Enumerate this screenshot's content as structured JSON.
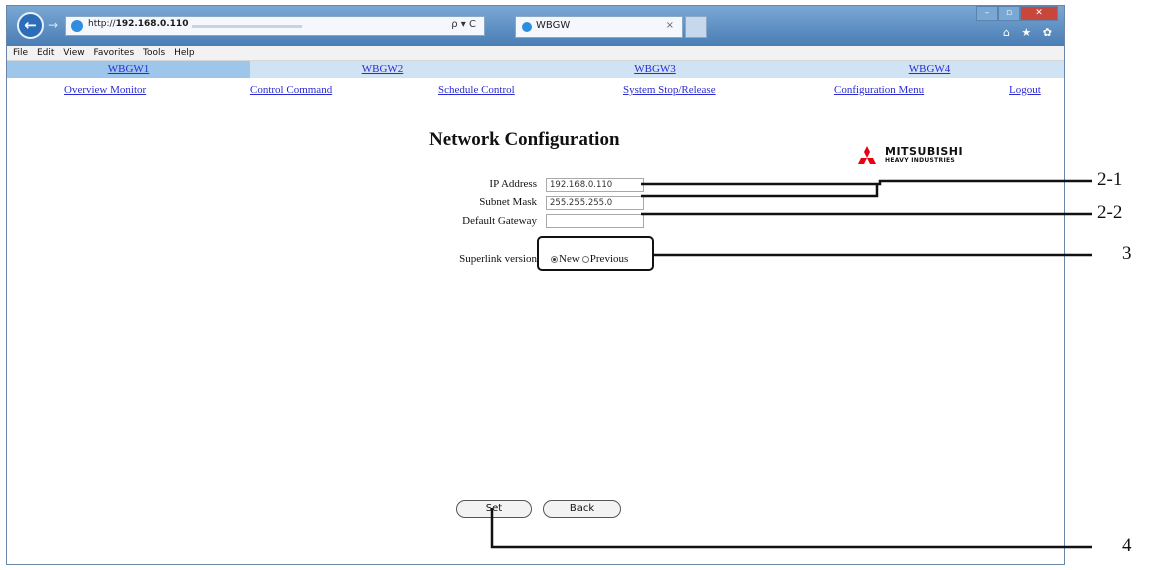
{
  "browser": {
    "url_host": "192.168.0.110",
    "url_prefix": "http://",
    "address_controls": "ρ ▾ C",
    "tab_label": "WBGW",
    "tab_close": "×",
    "window_controls": [
      "–",
      "▫",
      "✕"
    ],
    "toolbar_icons": "⌂ ★ ✿"
  },
  "menu": [
    "File",
    "Edit",
    "View",
    "Favorites",
    "Tools",
    "Help"
  ],
  "gateways": [
    "WBGW1",
    "WBGW2",
    "WBGW3",
    "WBGW4"
  ],
  "selected_gateway": "WBGW1",
  "nav": [
    "Overview Monitor",
    "Control Command",
    "Schedule Control",
    "System Stop/Release",
    "Configuration Menu",
    "Logout"
  ],
  "page": {
    "title": "Network Configuration",
    "logo_line1": "MITSUBISHI",
    "logo_line2": "HEAVY INDUSTRIES"
  },
  "form": {
    "ip_label": "IP Address",
    "ip_value": "192.168.0.110",
    "mask_label": "Subnet Mask",
    "mask_value": "255.255.255.0",
    "gateway_label": "Default Gateway",
    "gateway_value": "",
    "superlink_label": "Superlink version",
    "superlink_new": "New",
    "superlink_previous": "Previous",
    "superlink_selected": "New",
    "set_button": "Set",
    "back_button": "Back"
  },
  "callouts": [
    "2-1",
    "2-2",
    "3",
    "4"
  ]
}
